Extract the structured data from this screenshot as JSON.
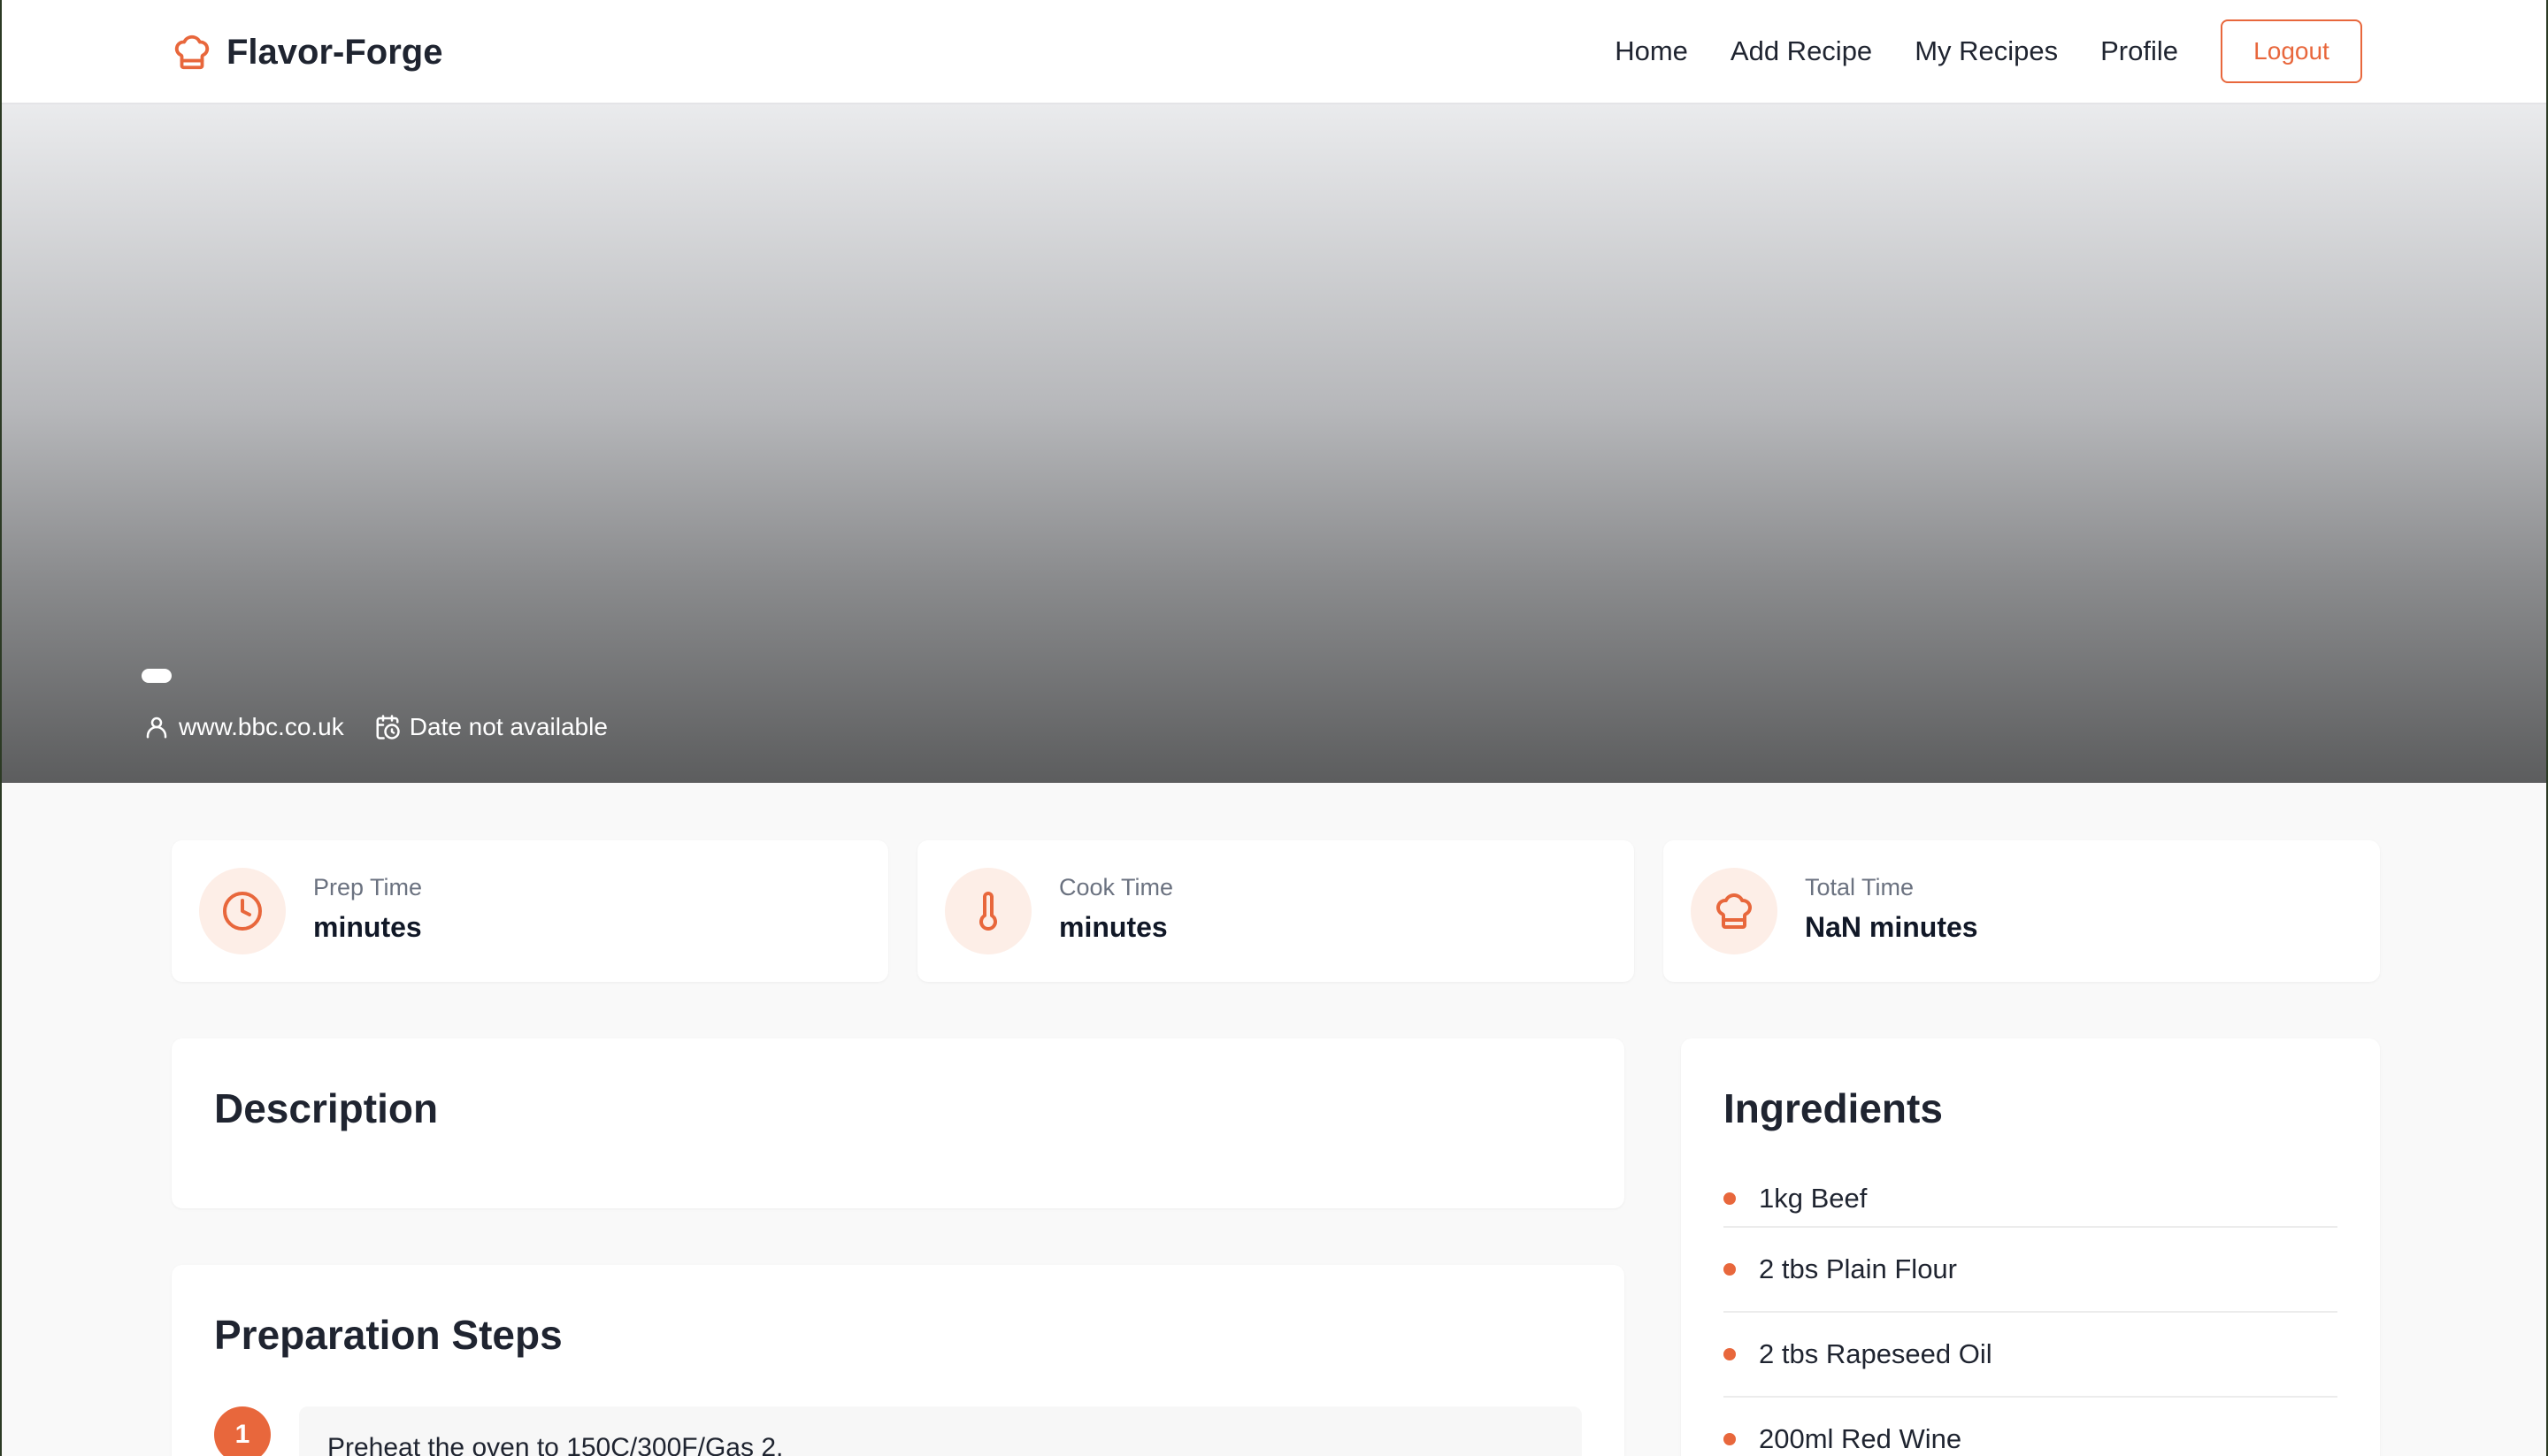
{
  "brand": {
    "name": "Flavor-Forge",
    "accent_color": "#e8673c"
  },
  "nav": {
    "links": [
      "Home",
      "Add Recipe",
      "My Recipes",
      "Profile"
    ],
    "logout_label": "Logout"
  },
  "hero": {
    "author": "www.bbc.co.uk",
    "date": "Date not available"
  },
  "times": [
    {
      "icon": "clock-icon",
      "label": "Prep Time",
      "value": "minutes"
    },
    {
      "icon": "thermometer-icon",
      "label": "Cook Time",
      "value": "minutes"
    },
    {
      "icon": "chef-hat-icon",
      "label": "Total Time",
      "value": "NaN minutes"
    }
  ],
  "description": {
    "title": "Description",
    "text": ""
  },
  "steps": {
    "title": "Preparation Steps",
    "items": [
      {
        "number": "1",
        "text": "Preheat the oven to 150C/300F/Gas 2."
      }
    ]
  },
  "ingredients": {
    "title": "Ingredients",
    "items": [
      "1kg Beef",
      "2 tbs Plain Flour",
      "2 tbs Rapeseed Oil",
      "200ml Red Wine"
    ]
  }
}
